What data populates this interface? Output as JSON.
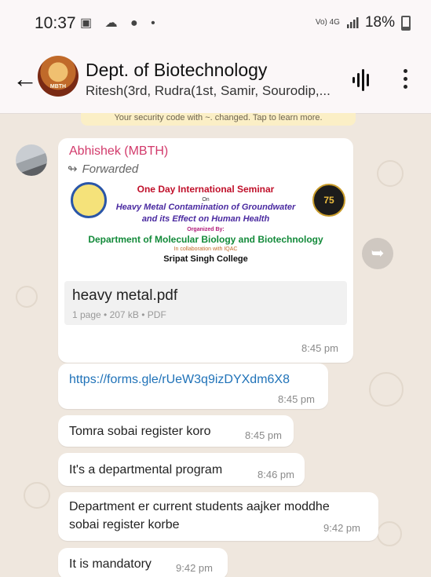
{
  "status_bar": {
    "time": "10:37",
    "left_icons": "▣ ☁ ● •",
    "signal_small": "Vo) 4G",
    "battery": "18%"
  },
  "header": {
    "title": "Dept. of Biotechnology",
    "subtitle": "Ritesh(3rd, Rudra(1st, Samir, Sourodip,...",
    "avatar_text": "MBTH"
  },
  "notice": "Your security code with ~. changed. Tap to learn more.",
  "messages": {
    "forwarded_doc": {
      "sender": "Abhishek (MBTH)",
      "forwarded_label": "Forwarded",
      "preview": {
        "line1": "One Day International Seminar",
        "line2": "On",
        "line3": "Heavy Metal Contamination of Groundwater",
        "line4": "and its Effect on Human Health",
        "line5": "Organized By:",
        "line6": "Department of Molecular Biology and Biotechnology",
        "line7": "In collaboration with IQAC",
        "line8": "Sripat Singh College",
        "badge": "75"
      },
      "file_name": "heavy metal.pdf",
      "file_meta": "1 page • 207 kB • PDF",
      "time": "8:45 pm"
    },
    "link": {
      "text": "https://forms.gle/rUeW3q9izDYXdm6X8",
      "time": "8:45 pm"
    },
    "m1": {
      "text": "Tomra sobai register koro",
      "time": "8:45 pm"
    },
    "m2": {
      "text": "It's a departmental program",
      "time": "8:46 pm"
    },
    "m3": {
      "line1": "Department er current students aajker moddhe",
      "line2": "sobai register korbe",
      "time": "9:42 pm"
    },
    "m4": {
      "text": "It is mandatory",
      "time": "9:42 pm"
    }
  }
}
